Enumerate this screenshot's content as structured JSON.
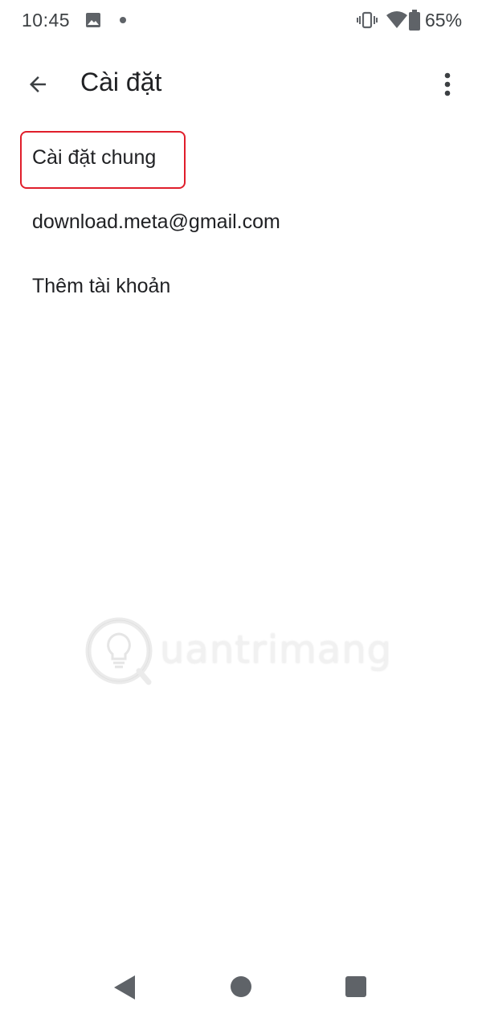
{
  "status_bar": {
    "time": "10:45",
    "battery": "65%",
    "icons": [
      "gallery-icon",
      "notification-dot-icon",
      "vibrate-icon",
      "wifi-icon",
      "battery-icon"
    ]
  },
  "app_bar": {
    "title": "Cài đặt",
    "back_icon": "arrow-back-icon",
    "overflow_icon": "more-vert-icon"
  },
  "settings_list": {
    "items": [
      {
        "label": "Cài đặt chung",
        "highlighted": true
      },
      {
        "label": "download.meta@gmail.com",
        "highlighted": false
      },
      {
        "label": "Thêm tài khoản",
        "highlighted": false
      }
    ]
  },
  "watermark": {
    "text": "uantrimang"
  },
  "nav_bar": {
    "icons": [
      "nav-back-icon",
      "nav-home-icon",
      "nav-recents-icon"
    ]
  },
  "colors": {
    "highlight": "#e01e2b",
    "text": "#202124",
    "icon": "#5f6368"
  }
}
